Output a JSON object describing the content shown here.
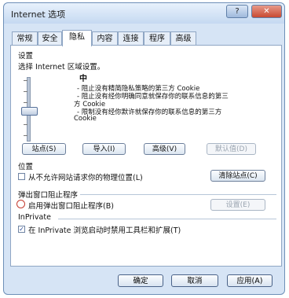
{
  "window": {
    "title": "Internet 选项",
    "help": "?",
    "close": "✕"
  },
  "tabs": [
    {
      "label": "常规",
      "active": false
    },
    {
      "label": "安全",
      "active": false
    },
    {
      "label": "隐私",
      "active": true
    },
    {
      "label": "内容",
      "active": false
    },
    {
      "label": "连接",
      "active": false
    },
    {
      "label": "程序",
      "active": false
    },
    {
      "label": "高级",
      "active": false
    }
  ],
  "settings": {
    "header": "设置",
    "subtitle": "选择 Internet 区域设置。",
    "level": "中",
    "desc_lines": [
      "- 阻止没有精简隐私策略的第三方 Cookie",
      "- 阻止没有经你明确同意就保存你的联系信息的第三",
      "方 Cookie",
      "- 限制没有经你默许就保存你的联系信息的第三方",
      "Cookie"
    ],
    "buttons": {
      "sites": "站点(S)",
      "import": "导入(I)",
      "advanced": "高级(V)",
      "default": "默认值(D)"
    }
  },
  "location": {
    "header": "位置",
    "never_allow": "从不允许网站请求你的物理位置(L)",
    "clear_sites": "清除站点(C)"
  },
  "popup": {
    "header": "弹出窗口阻止程序",
    "enable": "启用弹出窗口阻止程序(B)",
    "settings": "设置(E)"
  },
  "inprivate": {
    "header": "InPrivate",
    "disable_toolbars": "在 InPrivate 浏览启动时禁用工具栏和扩展(T)",
    "checkmark": "✓"
  },
  "footer": {
    "ok": "确定",
    "cancel": "取消",
    "apply": "应用(A)"
  }
}
